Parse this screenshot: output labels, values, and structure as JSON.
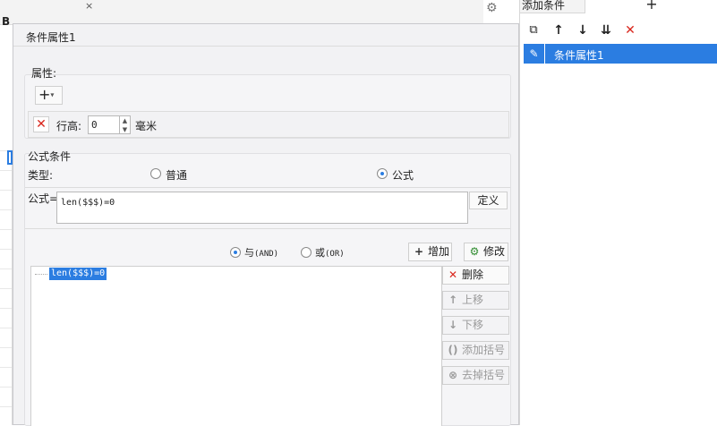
{
  "dialog": {
    "title": "条件属性1",
    "properties": {
      "label": "属性:",
      "add_icon": "plus-icon",
      "row_height": {
        "label": "行高:",
        "value": "0",
        "unit": "毫米"
      }
    },
    "formula_condition": {
      "label": "公式条件",
      "type_label": "类型:",
      "type_options": [
        "普通",
        "公式"
      ],
      "selected_type": "公式",
      "formula_label": "公式=",
      "formula_value": "len($$$)=0",
      "define_button": "定义",
      "logic_options": [
        {
          "label": "与",
          "suffix": "(AND)"
        },
        {
          "label": "或",
          "suffix": "(OR)"
        }
      ],
      "selected_logic": "与",
      "add_button": "增加",
      "modify_button": "修改",
      "conditions": [
        "len($$$)=0"
      ],
      "list_buttons": {
        "delete": "删除",
        "move_up": "上移",
        "move_down": "下移",
        "add_parenthesis": "添加括号",
        "remove_parenthesis": "去掉括号"
      }
    }
  },
  "right_panel": {
    "tab_label": "添加条件",
    "tab_plus": "+",
    "condition_items": [
      "条件属性1"
    ]
  },
  "background": {
    "bold_label": "B",
    "tab_close": "×"
  }
}
